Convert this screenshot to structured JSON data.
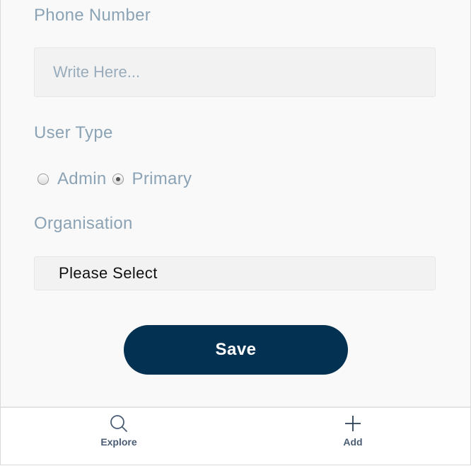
{
  "form": {
    "phone": {
      "label": "Phone Number",
      "placeholder": "Write Here...",
      "value": ""
    },
    "user_type": {
      "label": "User Type",
      "options": [
        {
          "label": "Admin",
          "checked": false
        },
        {
          "label": "Primary",
          "checked": true
        }
      ]
    },
    "organisation": {
      "label": "Organisation",
      "selected": "Please Select"
    },
    "save_label": "Save"
  },
  "tabbar": {
    "items": [
      {
        "label": "Explore",
        "icon": "search-icon"
      },
      {
        "label": "Add",
        "icon": "plus-icon"
      }
    ]
  },
  "colors": {
    "label": "#8ba3b5",
    "button": "#023152",
    "tab_label": "#4a5d75"
  }
}
